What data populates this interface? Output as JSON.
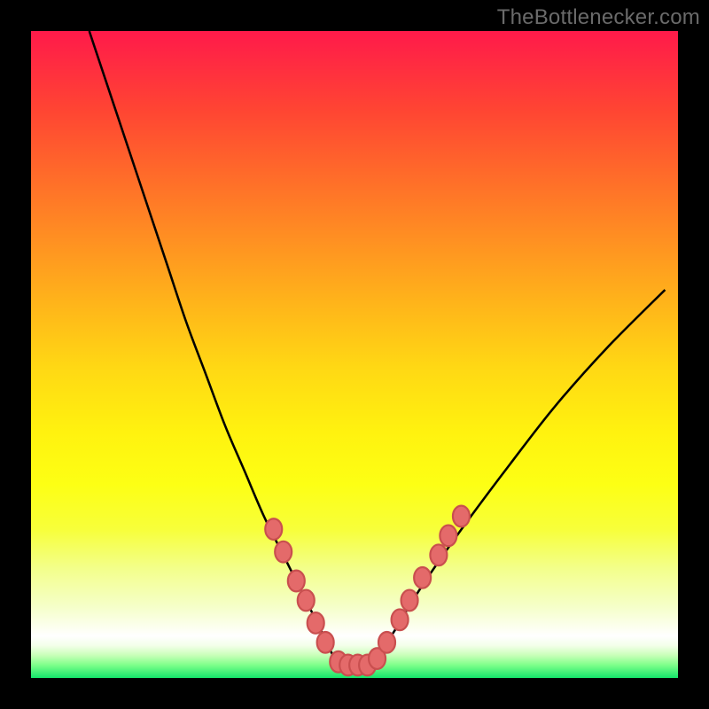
{
  "watermark": "TheBottlenecker.com",
  "colors": {
    "page_bg": "#000000",
    "curve": "#000000",
    "bead_fill": "#e46a6a",
    "bead_stroke": "#c94f4f"
  },
  "chart_data": {
    "type": "line",
    "title": "",
    "xlabel": "",
    "ylabel": "",
    "xlim": [
      0,
      100
    ],
    "ylim": [
      0,
      100
    ],
    "series": [
      {
        "name": "bottleneck-curve",
        "x": [
          9,
          12,
          15,
          18,
          21,
          24,
          27,
          30,
          33,
          36,
          39,
          41,
          43,
          45,
          47,
          49,
          51,
          53,
          56,
          59,
          63,
          68,
          74,
          81,
          89,
          98
        ],
        "y": [
          100,
          91,
          82,
          73,
          64,
          55,
          47,
          39,
          32,
          25,
          19,
          15,
          11,
          7,
          3,
          2,
          2,
          3,
          7,
          12,
          18,
          25,
          33,
          42,
          51,
          60
        ]
      }
    ],
    "markers": {
      "name": "highlight-beads",
      "points": [
        {
          "x": 37.5,
          "y": 23.0
        },
        {
          "x": 39.0,
          "y": 19.5
        },
        {
          "x": 41.0,
          "y": 15.0
        },
        {
          "x": 42.5,
          "y": 12.0
        },
        {
          "x": 44.0,
          "y": 8.5
        },
        {
          "x": 45.5,
          "y": 5.5
        },
        {
          "x": 47.5,
          "y": 2.5
        },
        {
          "x": 49.0,
          "y": 2.0
        },
        {
          "x": 50.5,
          "y": 2.0
        },
        {
          "x": 52.0,
          "y": 2.0
        },
        {
          "x": 53.5,
          "y": 3.0
        },
        {
          "x": 55.0,
          "y": 5.5
        },
        {
          "x": 57.0,
          "y": 9.0
        },
        {
          "x": 58.5,
          "y": 12.0
        },
        {
          "x": 60.5,
          "y": 15.5
        },
        {
          "x": 63.0,
          "y": 19.0
        },
        {
          "x": 64.5,
          "y": 22.0
        },
        {
          "x": 66.5,
          "y": 25.0
        }
      ],
      "radius": 1.3
    },
    "gradient_bands": [
      {
        "label": "red",
        "pct": 0
      },
      {
        "label": "orange",
        "pct": 35
      },
      {
        "label": "yellow",
        "pct": 65
      },
      {
        "label": "white",
        "pct": 93
      },
      {
        "label": "green",
        "pct": 100
      }
    ]
  }
}
